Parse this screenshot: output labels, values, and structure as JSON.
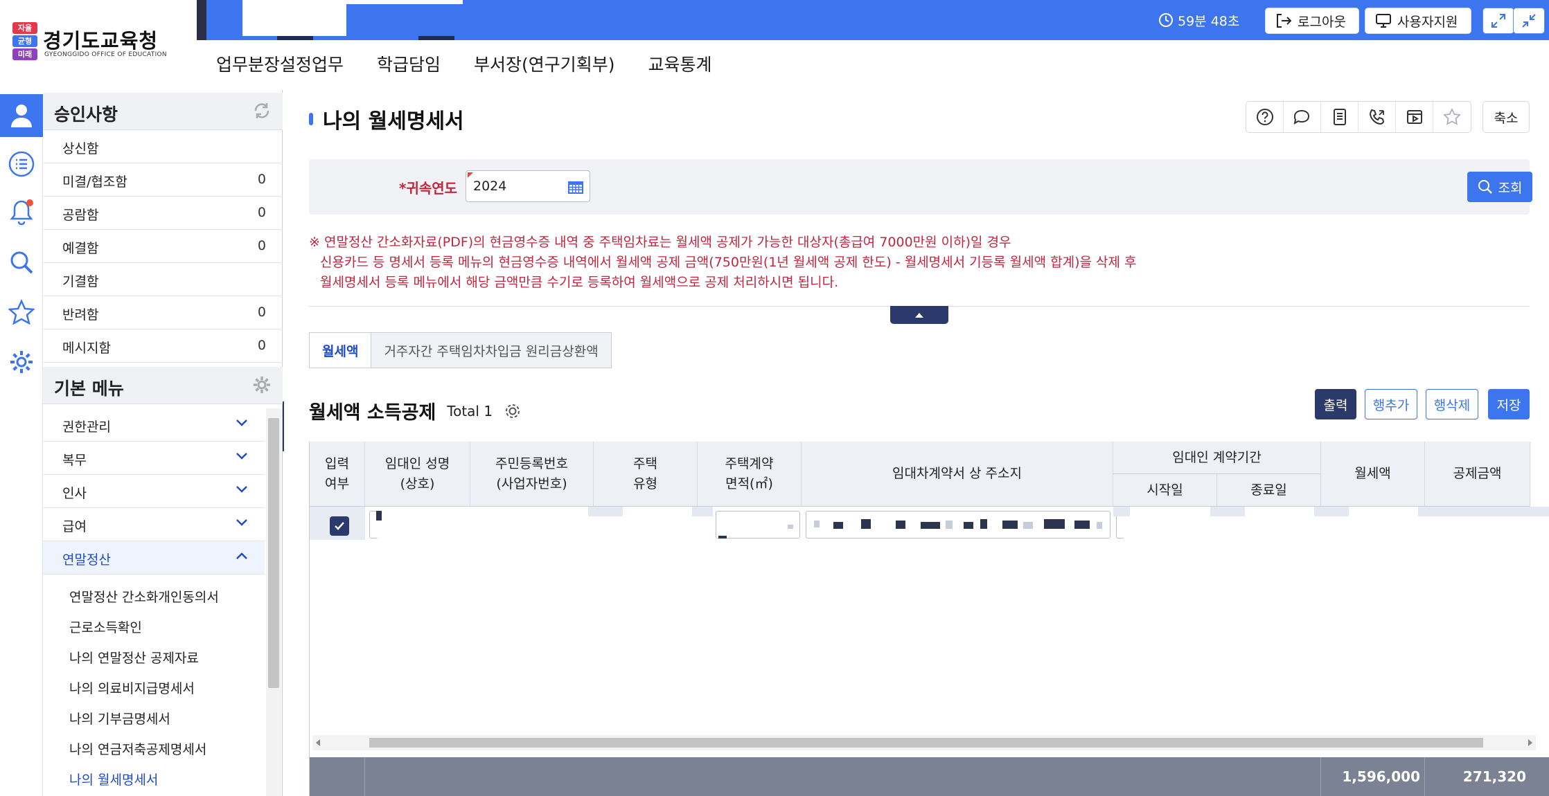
{
  "header": {
    "logo_text": "경기도교육청",
    "logo_subtext": "GYEONGGIDO OFFICE OF EDUCATION",
    "logo_mark": [
      "자율",
      "균형",
      "미래"
    ],
    "timer": "59분 48초",
    "logout_label": "로그아웃",
    "support_label": "사용자지원",
    "expand_icon": "expand-icon",
    "collapse_icon": "collapse-icon"
  },
  "main_nav": [
    "업무분장설정업무",
    "학급담임",
    "부서장(연구기획부)",
    "교육통계"
  ],
  "rail": {
    "items": [
      "user-icon",
      "list-icon",
      "bell-icon",
      "search-icon",
      "star-icon",
      "gear-icon"
    ],
    "active": "user-icon",
    "notification_on": "bell-icon"
  },
  "approvals": {
    "title": "승인사항",
    "items": [
      {
        "label": "상신함",
        "count": ""
      },
      {
        "label": "미결/협조함",
        "count": "0"
      },
      {
        "label": "공람함",
        "count": "0"
      },
      {
        "label": "예결함",
        "count": "0"
      },
      {
        "label": "기결함",
        "count": ""
      },
      {
        "label": "반려함",
        "count": "0"
      },
      {
        "label": "메시지함",
        "count": "0"
      }
    ]
  },
  "menu": {
    "title": "기본 메뉴",
    "groups": [
      {
        "label": "권한관리",
        "open": false
      },
      {
        "label": "복무",
        "open": false
      },
      {
        "label": "인사",
        "open": false
      },
      {
        "label": "급여",
        "open": false
      },
      {
        "label": "연말정산",
        "open": true
      }
    ],
    "subitems": [
      "연말정산 간소화개인동의서",
      "근로소득확인",
      "나의 연말정산 공제자료",
      "나의 의료비지급명세서",
      "나의 기부금명세서",
      "나의 연금저축공제명세서",
      "나의 월세명세서"
    ],
    "current": "나의 월세명세서"
  },
  "page": {
    "title": "나의 월세명세서",
    "toolbar_icons": [
      "help-icon",
      "chat-icon",
      "document-icon",
      "phone-icon",
      "video-icon",
      "star-icon"
    ],
    "shrink_label": "축소"
  },
  "search": {
    "year_label": "*귀속연도",
    "year_value": "2024",
    "query_label": "조회"
  },
  "notice": [
    "※ 연말정산 간소화자료(PDF)의 현금영수증 내역 중 주택임차료는 월세액 공제가 가능한 대상자(총급여 7000만원 이하)일 경우",
    "신용카드 등 명세서 등록 메뉴의 현금영수증 내역에서 월세액 공제 금액(750만원(1년 월세액 공제 한도) - 월세명세서 기등록 월세액 합계)을 삭제 후",
    "월세명세서 등록 메뉴에서 해당 금액만큼 수기로 등록하여 월세액으로 공제 처리하시면 됩니다."
  ],
  "tabs": [
    "월세액",
    "거주자간 주택임차차입금 원리금상환액"
  ],
  "section": {
    "title": "월세액 소득공제",
    "total_label": "Total 1",
    "print_label": "출력",
    "add_row_label": "행추가",
    "del_row_label": "행삭제",
    "save_label": "저장"
  },
  "grid": {
    "headers": [
      "입력\n여부",
      "임대인 성명\n(상호)",
      "주민등록번호\n(사업자번호)",
      "주택\n유형",
      "주택계약\n면적(㎡)",
      "임대차계약서 상 주소지",
      "임대인 계약기간",
      "시작일",
      "종료일",
      "월세액",
      "공제금액"
    ],
    "row_checked": true,
    "totals": {
      "rent": "1,596,000",
      "deduction": "271,320"
    }
  }
}
